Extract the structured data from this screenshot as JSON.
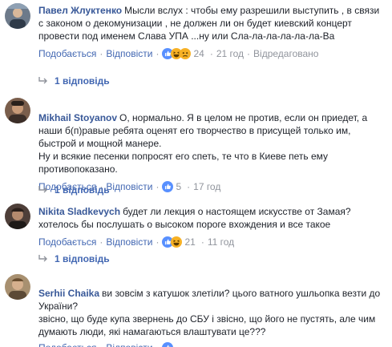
{
  "comments": [
    {
      "author": "Павел Жлуктенко",
      "text": "Мысли вслух : чтобы ему разрешили выступить , в связи с законом о декомунизации , не должен ли он будет киевский концерт провести под именем Слава УПА ...ну или Сла-ла-ла-ла-ла-ла-Ва",
      "like_label": "Подобається",
      "reply_label": "Відповісти",
      "reactions": [
        "like-icon",
        "haha-icon",
        "sad-icon"
      ],
      "reaction_count": "24",
      "time": "21 год",
      "edited": "Відредаговано",
      "replies": "1 відповідь",
      "avatar_color": "#6d7a8a"
    },
    {
      "author": "Mikhail Stoyanov",
      "text": "О, нормально. Я в целом не против, если он приедет, а наши б(п)равые ребята оценят его творчество в присущей только им, быстрой и мощной манере.\nНу и всякие песенки попросят его спеть, те что в Киеве петь ему противопоказано.",
      "like_label": "Подобається",
      "reply_label": "Відповісти",
      "reactions": [
        "like-icon"
      ],
      "reaction_count": "5",
      "time": "17 год",
      "edited": "",
      "replies": "1 відповідь",
      "avatar_color": "#7a5e4c"
    },
    {
      "author": "Nikita Sladkevych",
      "text": "будет ли лекция о настоящем искусстве от Замая? хотелось бы послушать о высоком пороге вхождения и все такое",
      "like_label": "Подобається",
      "reply_label": "Відповісти",
      "reactions": [
        "like-icon",
        "haha-icon"
      ],
      "reaction_count": "21",
      "time": "11 год",
      "edited": "",
      "replies": "1 відповідь",
      "avatar_color": "#4e3f39"
    },
    {
      "author": "Serhii Chaika",
      "text": "ви зовсім з катушок злетіли? цього ватного ушльопка везти до України?\nзвісно, що буде купа звернень до СБУ і звісно, що його не пустять, але чим думають люди, які намагаються влаштувати це???",
      "like_label": "Подобається",
      "reply_label": "Відповісти",
      "reactions": [
        "like-icon"
      ],
      "reaction_count": "",
      "time": "",
      "edited": "",
      "replies": "",
      "avatar_color": "#a89070"
    }
  ],
  "colors": {
    "link": "#4267b2",
    "author": "#385898",
    "meta": "#90949c",
    "like": "#5890ff",
    "haha": "#f7b125"
  }
}
